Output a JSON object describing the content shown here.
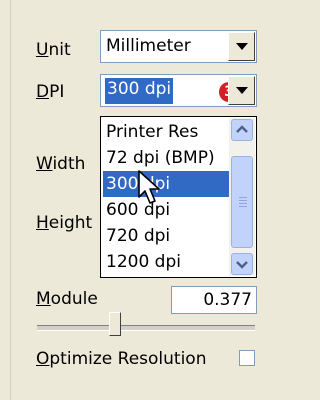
{
  "unit": {
    "label": "Unit",
    "value": "Millimeter"
  },
  "dpi": {
    "label": "DPI",
    "value": "300 dpi",
    "callout": "3"
  },
  "dropdown": {
    "options": [
      "Printer Res",
      "72 dpi (BMP)",
      "300 dpi",
      "600 dpi",
      "720 dpi",
      "1200 dpi"
    ],
    "selected_index": 2
  },
  "fields": {
    "width_label": "Width",
    "height_label": "Height",
    "module_label": "Module",
    "module_value": "0.377"
  },
  "slider": {
    "position_fraction": 0.36
  },
  "optimize": {
    "label": "Optimize Resolution",
    "checked": false
  },
  "colors": {
    "selection": "#316ac5",
    "panel": "#ece9d8",
    "callout": "#d51f26"
  }
}
